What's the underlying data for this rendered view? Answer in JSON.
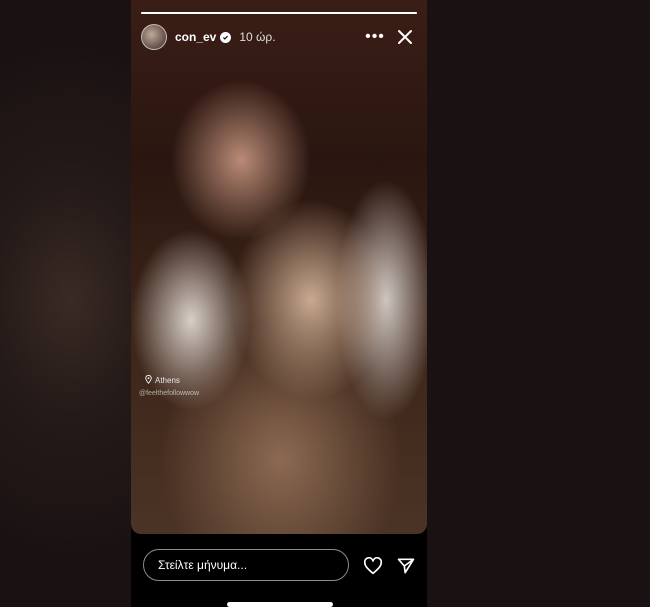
{
  "story": {
    "progress": 1.0,
    "header": {
      "username": "con_ev",
      "time": "10 ώρ.",
      "more_label": "•••",
      "verified": true
    },
    "stickers": {
      "location": "Athens",
      "mention": "@feelthefollowwow"
    },
    "footer": {
      "message_placeholder": "Στείλτε μήνυμα..."
    }
  },
  "icons": {
    "verified": "verified-badge-icon",
    "more": "more-options-icon",
    "close": "close-icon",
    "location": "location-pin-icon",
    "like": "heart-icon",
    "send": "send-icon"
  },
  "colors": {
    "background": "#1a1212",
    "story_background": "#000000",
    "text": "#ffffff"
  }
}
